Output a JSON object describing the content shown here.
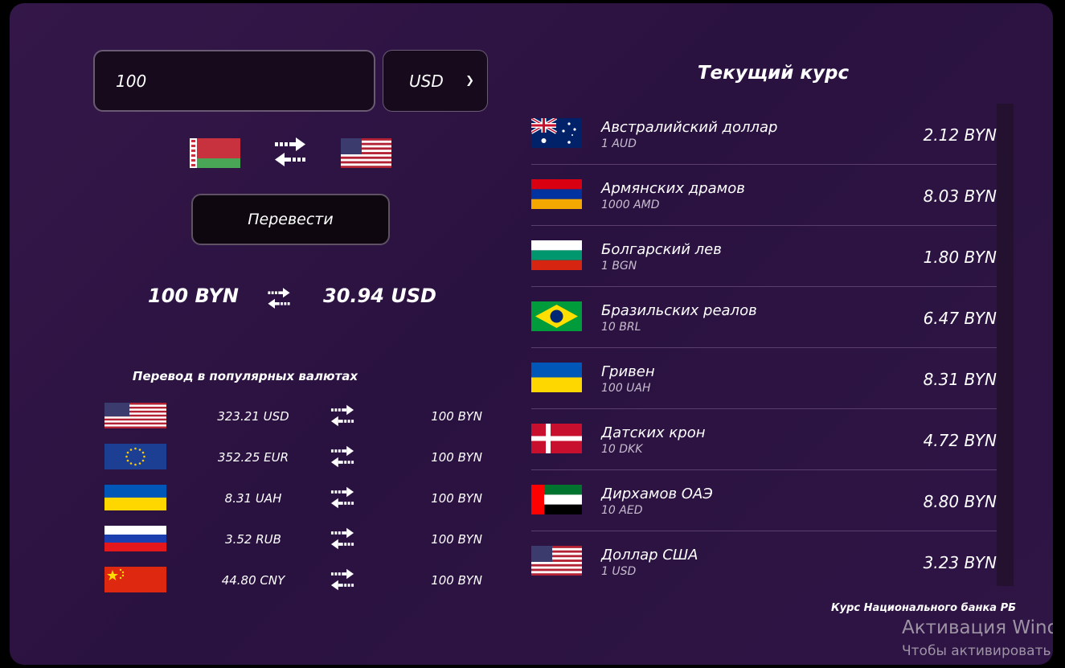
{
  "converter": {
    "amount": "100",
    "currency": "USD",
    "convert_label": "Перевести",
    "result_from": "100 BYN",
    "result_to": "30.94 USD",
    "from_flag": "by-flag-icon",
    "to_flag": "us-flag-icon"
  },
  "popular": {
    "title": "Перевод в популярных валютах",
    "rows": [
      {
        "flag": "us-flag-icon",
        "from": "323.21 USD",
        "to": "100 BYN"
      },
      {
        "flag": "eu-flag-icon",
        "from": "352.25 EUR",
        "to": "100 BYN"
      },
      {
        "flag": "ua-flag-icon",
        "from": "8.31 UAH",
        "to": "100 BYN"
      },
      {
        "flag": "ru-flag-icon",
        "from": "3.52 RUB",
        "to": "100 BYN"
      },
      {
        "flag": "cn-flag-icon",
        "from": "44.80 CNY",
        "to": "100 BYN"
      }
    ]
  },
  "rates": {
    "title": "Текущий курс",
    "items": [
      {
        "flag": "au-flag-icon",
        "name": "Австралийский доллар",
        "unit": "1 AUD",
        "value": "2.12 BYN"
      },
      {
        "flag": "am-flag-icon",
        "name": "Армянских драмов",
        "unit": "1000 AMD",
        "value": "8.03 BYN"
      },
      {
        "flag": "bg-flag-icon",
        "name": "Болгарский лев",
        "unit": "1 BGN",
        "value": "1.80 BYN"
      },
      {
        "flag": "br-flag-icon",
        "name": "Бразильских реалов",
        "unit": "10 BRL",
        "value": "6.47 BYN"
      },
      {
        "flag": "ua-flag-icon",
        "name": "Гривен",
        "unit": "100 UAH",
        "value": "8.31 BYN"
      },
      {
        "flag": "dk-flag-icon",
        "name": "Датских крон",
        "unit": "10 DKK",
        "value": "4.72 BYN"
      },
      {
        "flag": "ae-flag-icon",
        "name": "Дирхамов ОАЭ",
        "unit": "10 AED",
        "value": "8.80 BYN"
      },
      {
        "flag": "us-flag-icon",
        "name": "Доллар США",
        "unit": "1 USD",
        "value": "3.23 BYN"
      }
    ],
    "source_note": "Курс Национального банка РБ"
  },
  "windows_watermark": {
    "line1": "Активация Windo",
    "line2": "Чтобы активировать Win"
  }
}
